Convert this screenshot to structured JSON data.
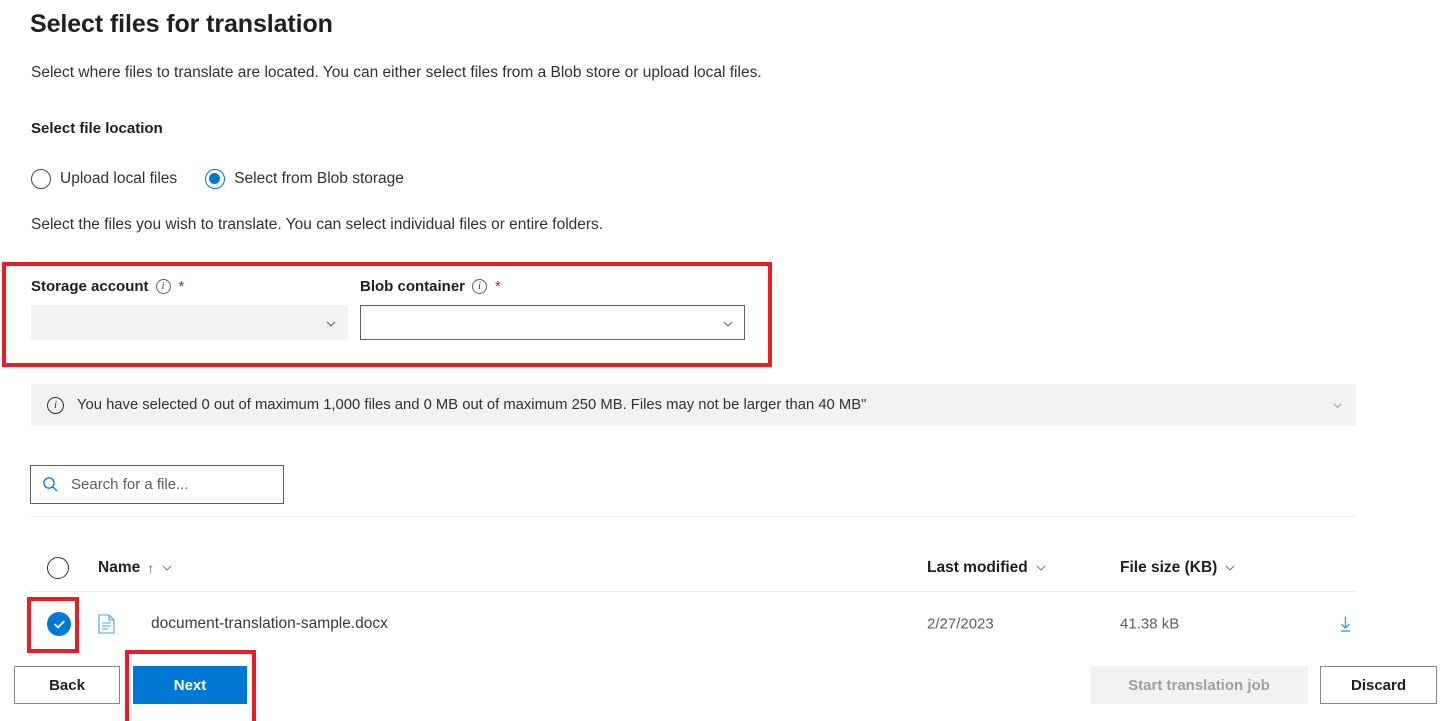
{
  "page": {
    "title": "Select files for translation",
    "intro": "Select where files to translate are located. You can either select files from a Blob store or upload local files.",
    "section_label": "Select file location",
    "helper": "Select the files you wish to translate. You can select individual files or entire folders."
  },
  "file_location": {
    "options": [
      {
        "label": "Upload local files",
        "selected": false
      },
      {
        "label": "Select from Blob storage",
        "selected": true
      }
    ]
  },
  "fields": {
    "storage_account": {
      "label": "Storage account",
      "info_icon": "info-icon",
      "required_marker": "*",
      "value": "",
      "disabled": true,
      "chevron_icon": "chevron-down-icon"
    },
    "blob_container": {
      "label": "Blob container",
      "info_icon": "info-icon",
      "required_marker": "*",
      "value": "",
      "disabled": false,
      "chevron_icon": "chevron-down-icon"
    }
  },
  "message_bar": {
    "icon": "info-icon",
    "text": "You have selected 0 out of maximum 1,000 files and 0 MB out of maximum 250 MB. Files may not be larger than 40 MB\"",
    "expand_icon": "chevron-down-icon"
  },
  "search": {
    "icon": "search-icon",
    "placeholder": "Search for a file...",
    "value": ""
  },
  "table": {
    "select_all": {
      "icon": "circle-unchecked-icon",
      "checked": false
    },
    "columns": [
      {
        "label": "Name",
        "sort": "↑",
        "chevron_icon": "chevron-down-icon"
      },
      {
        "label": "Last modified",
        "chevron_icon": "chevron-down-icon"
      },
      {
        "label": "File size (KB)",
        "chevron_icon": "chevron-down-icon"
      }
    ],
    "rows": [
      {
        "checked": true,
        "check_icon": "circle-checked-icon",
        "file_icon": "document-file-icon",
        "name": "document-translation-sample.docx",
        "last_modified": "2/27/2023",
        "file_size": "41.38 kB",
        "download_icon": "download-icon"
      }
    ]
  },
  "footer": {
    "back": "Back",
    "next": "Next",
    "start": "Start translation job",
    "discard": "Discard"
  },
  "colors": {
    "accent": "#0078d4",
    "annotation": "#ec1c24",
    "required": "#a4262c",
    "disabled_bg": "#f3f2f1",
    "disabled_text": "#a19f9d",
    "messagebar_bg": "#f3f2f1"
  }
}
